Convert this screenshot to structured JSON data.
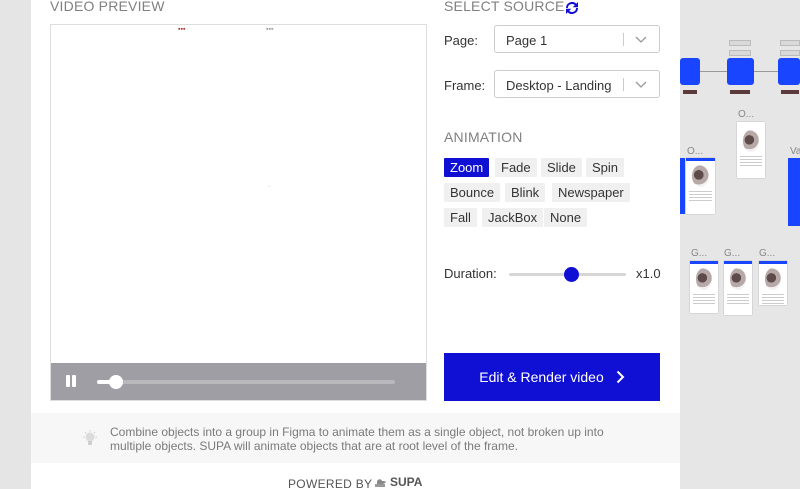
{
  "video_preview": {
    "title": "VIDEO PREVIEW",
    "progress": 0.04
  },
  "source": {
    "title": "SELECT SOURCE",
    "page_label": "Page:",
    "page_value": "Page 1",
    "frame_label": "Frame:",
    "frame_value": "Desktop - Landing"
  },
  "animation": {
    "title": "ANIMATION",
    "options": [
      "Zoom",
      "Fade",
      "Slide",
      "Spin",
      "Bounce",
      "Blink",
      "Newspaper",
      "Fall",
      "JackBox",
      "None"
    ],
    "selected": "Zoom"
  },
  "duration": {
    "label": "Duration:",
    "value_text": "x1.0",
    "level": 0.5
  },
  "render_button": "Edit & Render video",
  "tip": "Combine objects into a group in Figma to animate them as a single object, not broken up into multiple objects. SUPA will animate objects that are at root level of the frame.",
  "footer": {
    "powered_by": "POWERED BY",
    "brand": "SUPA"
  },
  "canvas_labels": [
    "O...",
    "O...",
    "Va",
    "G...",
    "G...",
    "G..."
  ],
  "colors": {
    "accent": "#1010d4",
    "player_bar": "#9e9ea4",
    "canvas_blue": "#1a45ff"
  }
}
